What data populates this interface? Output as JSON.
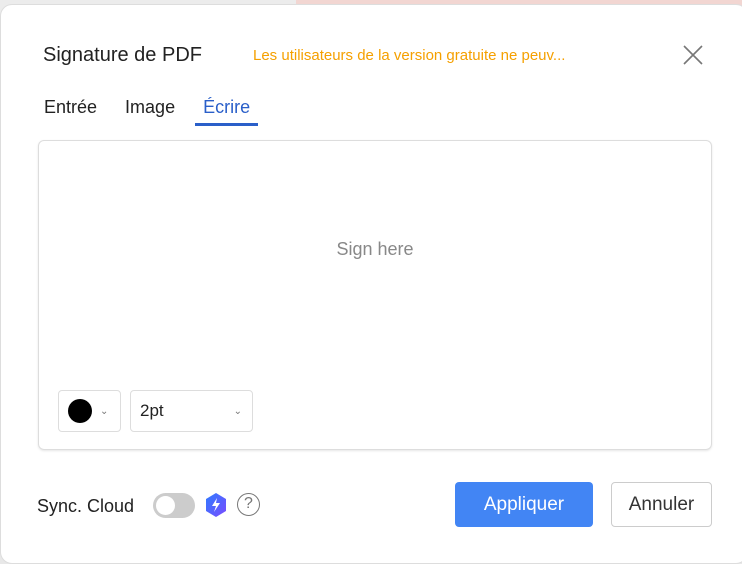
{
  "dialog": {
    "title": "Signature de PDF",
    "warning": "Les utilisateurs de la version gratuite ne peuv...",
    "tabs": [
      {
        "label": "Entrée"
      },
      {
        "label": "Image"
      },
      {
        "label": "Écrire"
      }
    ],
    "active_tab": "Écrire",
    "placeholder": "Sign here",
    "pen_color": "#000000",
    "pen_size": "2pt",
    "sync_label": "Sync. Cloud",
    "sync_enabled": false,
    "help": "?",
    "apply_label": "Appliquer",
    "cancel_label": "Annuler"
  },
  "colors": {
    "accent": "#4285f4",
    "warning": "#f5a000",
    "tab_active": "#2a5fc9"
  }
}
